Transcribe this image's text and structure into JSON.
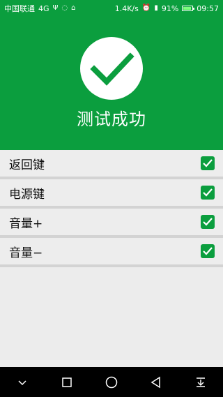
{
  "status": {
    "carrier": "中国联通",
    "network": "4G",
    "speed": "1.4K/s",
    "battery": "91%",
    "time": "09:57"
  },
  "header": {
    "title": "测试成功",
    "bg_color": "#0b9e3e"
  },
  "list": {
    "items": [
      {
        "label": "返回键",
        "checked": true
      },
      {
        "label": "电源键",
        "checked": true
      },
      {
        "label": "音量+",
        "checked": true
      },
      {
        "label": "音量−",
        "checked": true
      }
    ]
  },
  "icons": [
    "usb-icon",
    "sync-icon",
    "alarm-icon",
    "signal-icon",
    "battery-icon",
    "checkmark-icon",
    "back-icon",
    "home-icon",
    "recents-icon",
    "notifications-icon",
    "collapse-icon"
  ]
}
